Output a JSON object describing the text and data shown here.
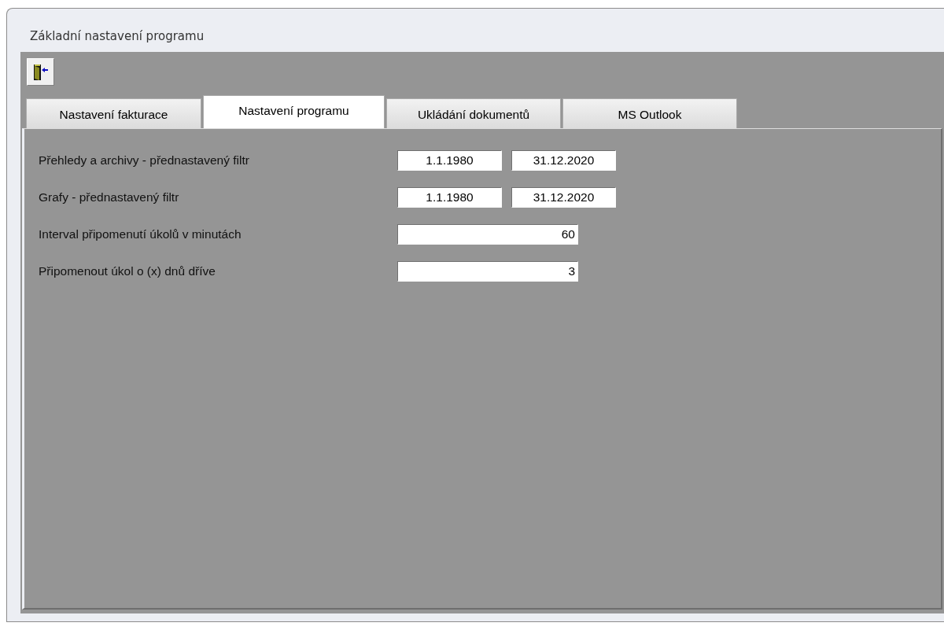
{
  "window": {
    "title": "Základní nastavení programu"
  },
  "toolbar": [
    {
      "kind": "exit"
    }
  ],
  "tabs": [
    {
      "label": "Nastavení fakturace",
      "selected": false
    },
    {
      "label": "Nastavení programu",
      "selected": true
    },
    {
      "label": "Ukládání dokumentů",
      "selected": false
    },
    {
      "label": "MS Outlook",
      "selected": false
    }
  ],
  "fields": [
    {
      "label": "Přehledy a archivy - přednastavený filtr",
      "kind": "range",
      "values": [
        "1.1.1980",
        "31.12.2020"
      ]
    },
    {
      "label": "Grafy - přednastavený filtr",
      "kind": "range",
      "values": [
        "1.1.1980",
        "31.12.2020"
      ]
    },
    {
      "label": "Interval připomenutí úkolů v minutách",
      "kind": "number",
      "values": [
        "60"
      ]
    },
    {
      "label": "Připomenout úkol o (x) dnů dříve",
      "kind": "number",
      "values": [
        "3"
      ]
    }
  ]
}
